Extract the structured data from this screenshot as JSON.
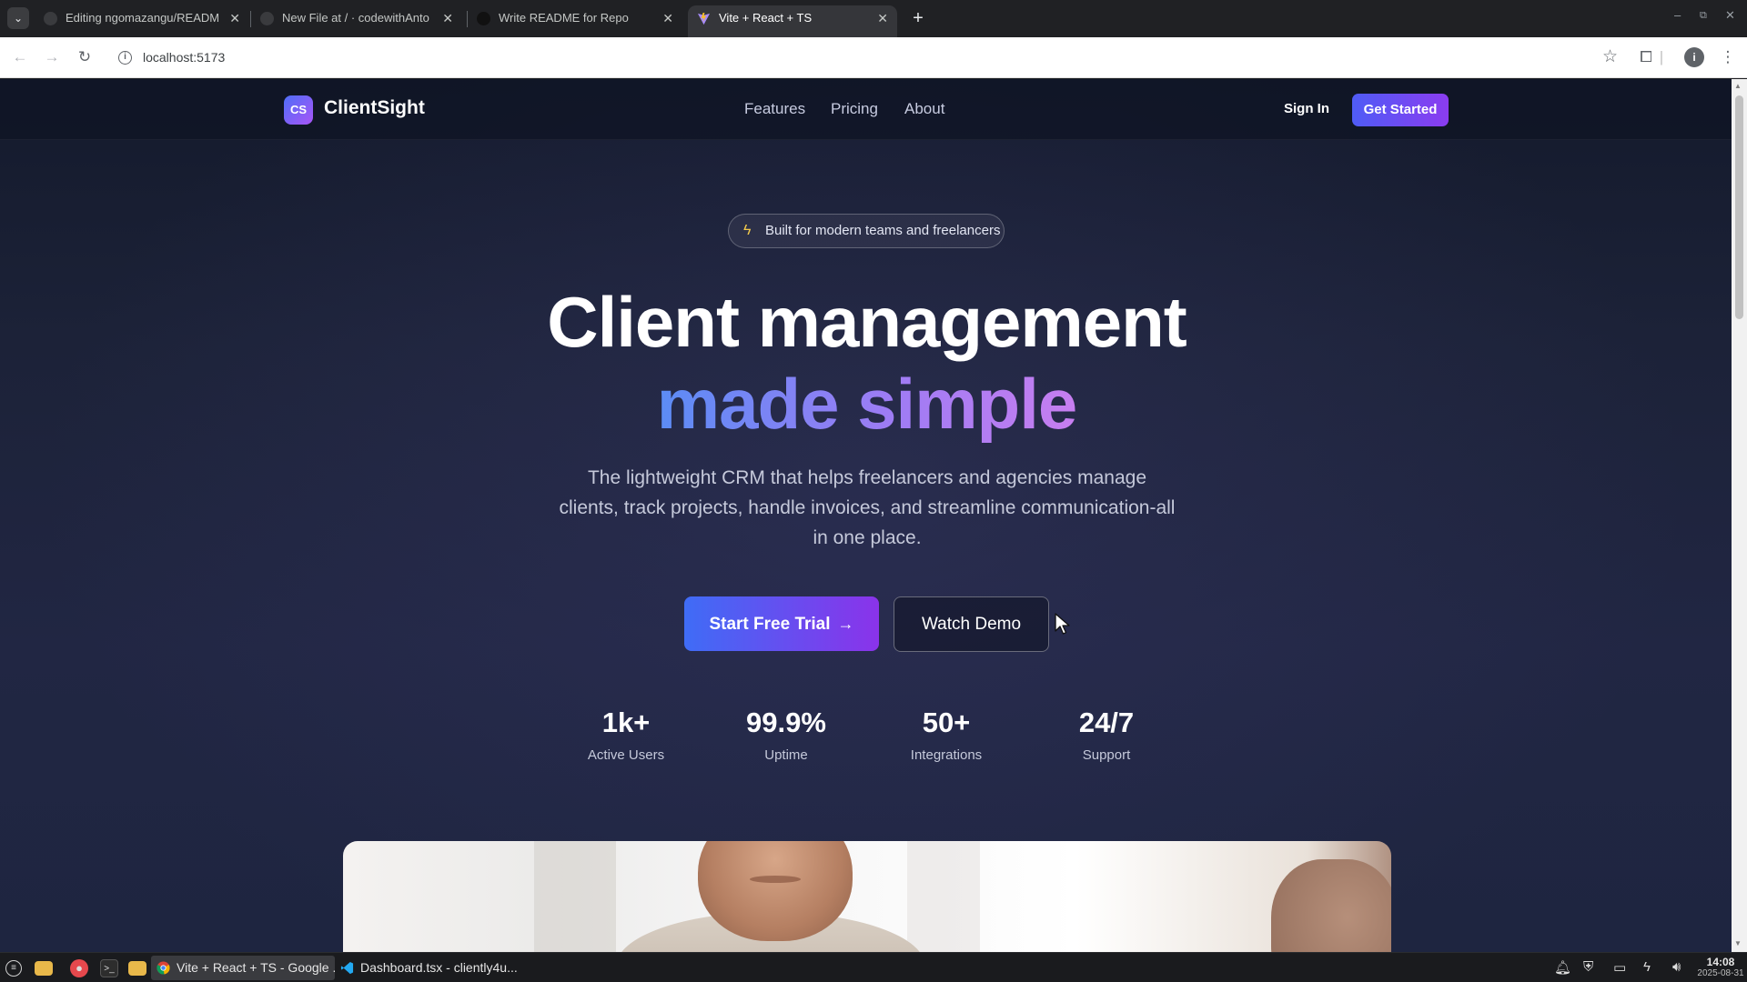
{
  "browser": {
    "tabs": [
      {
        "title": "Editing ngomazangu/READM",
        "active": false
      },
      {
        "title": "New File at / · codewithAnto",
        "active": false
      },
      {
        "title": "Write README for Repo",
        "active": false
      },
      {
        "title": "Vite + React + TS",
        "active": true
      }
    ],
    "url": "localhost:5173",
    "profile_initial": "i"
  },
  "site": {
    "logo_mark": "CS",
    "brand": "ClientSight",
    "nav": [
      "Features",
      "Pricing",
      "About"
    ],
    "sign_in": "Sign In",
    "get_started": "Get Started"
  },
  "hero": {
    "badge": "Built for modern teams and freelancers",
    "title_line1": "Client management",
    "title_line2": "made simple",
    "subtitle": "The lightweight CRM that helps freelancers and agencies manage clients, track projects, handle invoices, and streamline communication-all in one place.",
    "primary_cta": "Start Free Trial",
    "secondary_cta": "Watch Demo",
    "accent_gradient": [
      "#5b8cf5",
      "#9d7cf4",
      "#c77ef0"
    ]
  },
  "stats": [
    {
      "value": "1k+",
      "label": "Active Users"
    },
    {
      "value": "99.9%",
      "label": "Uptime"
    },
    {
      "value": "50+",
      "label": "Integrations"
    },
    {
      "value": "24/7",
      "label": "Support"
    }
  ],
  "taskbar": {
    "apps": [
      {
        "title": "Vite + React + TS - Google ...",
        "icon": "chrome-icon",
        "active": true
      },
      {
        "title": "Dashboard.tsx - cliently4u...",
        "icon": "vscode-icon",
        "active": false
      }
    ],
    "time": "14:08",
    "date": "2025-08-31"
  },
  "colors": {
    "brand_button": "#5a52f5",
    "page_background": "#1f2440"
  }
}
